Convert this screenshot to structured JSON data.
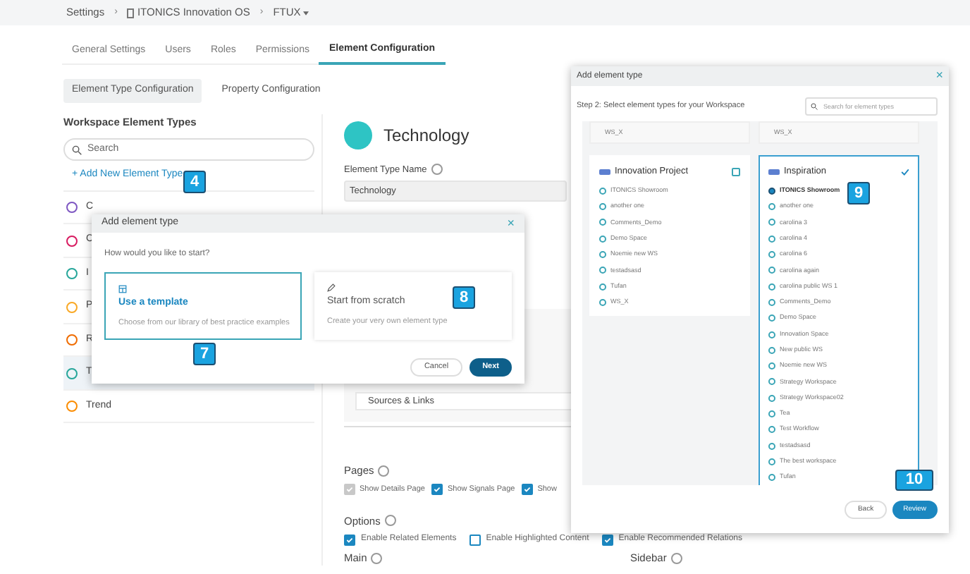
{
  "breadcrumb": [
    "Settings",
    "ITONICS Innovation OS",
    "FTUX"
  ],
  "breadcrumb_separators": [
    "›",
    "›"
  ],
  "tabs": [
    {
      "label": "General Settings",
      "selected": false
    },
    {
      "label": "Users",
      "selected": false
    },
    {
      "label": "Roles",
      "selected": false
    },
    {
      "label": "Permissions",
      "selected": false
    },
    {
      "label": "Element Configuration",
      "selected": true
    }
  ],
  "subtabs": [
    {
      "label": "Element Type Configuration",
      "selected": true
    },
    {
      "label": "Property Configuration",
      "selected": false
    }
  ],
  "sidebar": {
    "title": "Workspace Element Types",
    "search_placeholder": "Search",
    "add_link": "+ Add New Element Type",
    "items": [
      {
        "label": "C",
        "selected": false,
        "color": "#7e57c2"
      },
      {
        "label": "C",
        "selected": false,
        "color": "#d81b60"
      },
      {
        "label": "I",
        "selected": false,
        "color": "#26a69a"
      },
      {
        "label": "P",
        "selected": false,
        "color": "#f9a825"
      },
      {
        "label": "R",
        "selected": false,
        "color": "#ef6c00"
      },
      {
        "label": "T",
        "selected": true,
        "color": "#26a69a"
      },
      {
        "label": "Trend",
        "selected": false,
        "color": "#fb8c00"
      }
    ]
  },
  "detail": {
    "title": "Technology",
    "name_label": "Element Type Name",
    "name_value": "Technology",
    "list_items": [
      "Sources & Links"
    ],
    "pages_label": "Pages",
    "pages": [
      {
        "label": "Show Details Page",
        "checked": true,
        "disabled": true
      },
      {
        "label": "Show Signals Page",
        "checked": true,
        "disabled": false
      },
      {
        "label": "Show",
        "checked": true,
        "disabled": false
      }
    ],
    "options_label": "Options",
    "options": [
      {
        "label": "Enable Related Elements",
        "checked": true
      },
      {
        "label": "Enable Highlighted Content",
        "checked": false
      },
      {
        "label": "Enable Recommended Relations",
        "checked": true
      }
    ],
    "main_label": "Main",
    "sidebar_label": "Sidebar"
  },
  "dialog_start": {
    "title": "Add element type",
    "close": "×",
    "question": "How would you like to start?",
    "choices": [
      {
        "kind": "template",
        "title": "Use a template",
        "description": "Choose from our library of best practice examples",
        "selected": true
      },
      {
        "kind": "scratch",
        "title": "Start from scratch",
        "description": "Create your very own element type",
        "selected": false
      }
    ],
    "buttons": [
      "Cancel",
      "Next"
    ]
  },
  "dialog_select": {
    "title": "Add element type",
    "close": "×",
    "step": "Step 2: Select element types for your Workspace",
    "search_placeholder": "Search for element types",
    "top_cards": [
      "WS_X",
      "WS_X"
    ],
    "cards": [
      {
        "selected": false,
        "name": "Innovation Project",
        "items": [
          {
            "label": "ITONICS Showroom",
            "selected": false
          },
          {
            "label": "another one",
            "selected": false
          },
          {
            "label": "Comments_Demo",
            "selected": false
          },
          {
            "label": "Demo Space",
            "selected": false
          },
          {
            "label": "Noemie new WS",
            "selected": false
          },
          {
            "label": "testadsasd",
            "selected": false
          },
          {
            "label": "Tufan",
            "selected": false
          },
          {
            "label": "WS_X",
            "selected": false
          }
        ]
      },
      {
        "selected": true,
        "name": "Inspiration",
        "items": [
          {
            "label": "ITONICS Showroom",
            "selected": true
          },
          {
            "label": "another one",
            "selected": false
          },
          {
            "label": "carolina 3",
            "selected": false
          },
          {
            "label": "carolina 4",
            "selected": false
          },
          {
            "label": "carolina 6",
            "selected": false
          },
          {
            "label": "carolina again",
            "selected": false
          },
          {
            "label": "carolina public WS 1",
            "selected": false
          },
          {
            "label": "Comments_Demo",
            "selected": false
          },
          {
            "label": "Demo Space",
            "selected": false
          },
          {
            "label": "Innovation Space",
            "selected": false
          },
          {
            "label": "New public WS",
            "selected": false
          },
          {
            "label": "Noemie new WS",
            "selected": false
          },
          {
            "label": "Strategy Workspace",
            "selected": false
          },
          {
            "label": "Strategy Workspace02",
            "selected": false
          },
          {
            "label": "Tea",
            "selected": false
          },
          {
            "label": "Test Workflow",
            "selected": false
          },
          {
            "label": "testadsasd",
            "selected": false
          },
          {
            "label": "The best workspace",
            "selected": false
          },
          {
            "label": "Tufan",
            "selected": false
          }
        ]
      }
    ],
    "buttons": [
      "Back",
      "Review"
    ]
  },
  "step_badges": [
    "4",
    "7",
    "8",
    "9",
    "10"
  ]
}
